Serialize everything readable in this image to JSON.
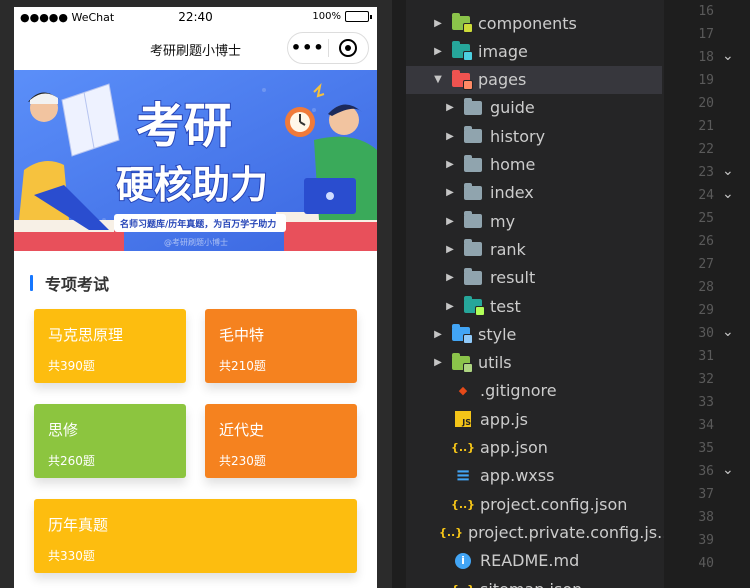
{
  "phone": {
    "status": {
      "signal": "●●●●● WeChat",
      "time": "22:40",
      "battery_text": "100%",
      "battery_level": 1.0
    },
    "navbar": {
      "title": "考研刷题小博士",
      "menu_icon": "more-dots-icon",
      "close_icon": "target-icon"
    },
    "banner": {
      "headline_1": "考研",
      "headline_2": "硬核助力",
      "tagline": "名师习题库/历年真题，为百万学子助力",
      "watermark": "@考研刷题小博士"
    },
    "section": {
      "title": "专项考试",
      "accent": "#1677ff"
    },
    "cards": [
      {
        "name": "马克思原理",
        "count": "共390题",
        "color": "#fdbd0f"
      },
      {
        "name": "毛中特",
        "count": "共210题",
        "color": "#f5821f"
      },
      {
        "name": "思修",
        "count": "共260题",
        "color": "#8cc53f"
      },
      {
        "name": "近代史",
        "count": "共230题",
        "color": "#f5821f"
      },
      {
        "name": "历年真题",
        "count": "共330题",
        "color": "#fdbd0f"
      }
    ]
  },
  "explorer": {
    "items": [
      {
        "label": "components",
        "kind": "folder",
        "icon": "folder-components-icon",
        "arrow": "▶"
      },
      {
        "label": "image",
        "kind": "folder",
        "icon": "folder-image-icon",
        "arrow": "▶"
      },
      {
        "label": "pages",
        "kind": "folder",
        "icon": "folder-pages-icon",
        "arrow": "▼"
      },
      {
        "label": "guide",
        "kind": "folder",
        "icon": "folder-icon",
        "arrow": "▶"
      },
      {
        "label": "history",
        "kind": "folder",
        "icon": "folder-icon",
        "arrow": "▶"
      },
      {
        "label": "home",
        "kind": "folder",
        "icon": "folder-icon",
        "arrow": "▶"
      },
      {
        "label": "index",
        "kind": "folder",
        "icon": "folder-icon",
        "arrow": "▶"
      },
      {
        "label": "my",
        "kind": "folder",
        "icon": "folder-icon",
        "arrow": "▶"
      },
      {
        "label": "rank",
        "kind": "folder",
        "icon": "folder-icon",
        "arrow": "▶"
      },
      {
        "label": "result",
        "kind": "folder",
        "icon": "folder-icon",
        "arrow": "▶"
      },
      {
        "label": "test",
        "kind": "folder",
        "icon": "folder-test-icon",
        "arrow": "▶"
      },
      {
        "label": "style",
        "kind": "folder",
        "icon": "folder-style-icon",
        "arrow": "▶"
      },
      {
        "label": "utils",
        "kind": "folder",
        "icon": "folder-utils-icon",
        "arrow": "▶"
      },
      {
        "label": ".gitignore",
        "kind": "file",
        "icon": "git-icon",
        "glyph": "◆"
      },
      {
        "label": "app.js",
        "kind": "file",
        "icon": "javascript-icon",
        "glyph": "JS"
      },
      {
        "label": "app.json",
        "kind": "file",
        "icon": "json-icon",
        "glyph": "{..}"
      },
      {
        "label": "app.wxss",
        "kind": "file",
        "icon": "css-icon",
        "glyph": "≡"
      },
      {
        "label": "project.config.json",
        "kind": "file",
        "icon": "json-icon",
        "glyph": "{..}"
      },
      {
        "label": "project.private.config.js...",
        "kind": "file",
        "icon": "json-icon",
        "glyph": "{..}"
      },
      {
        "label": "README.md",
        "kind": "file",
        "icon": "info-icon",
        "glyph": "i"
      },
      {
        "label": "sitemap.json",
        "kind": "file",
        "icon": "json-icon",
        "glyph": "{..}"
      }
    ]
  },
  "gutter": {
    "lines": [
      "16",
      "17",
      "18",
      "19",
      "20",
      "21",
      "22",
      "23",
      "24",
      "25",
      "26",
      "27",
      "28",
      "29",
      "30",
      "31",
      "32",
      "33",
      "34",
      "35",
      "36",
      "37",
      "38",
      "39",
      "40"
    ],
    "folds": [
      "18",
      "23",
      "24",
      "30",
      "36"
    ]
  }
}
